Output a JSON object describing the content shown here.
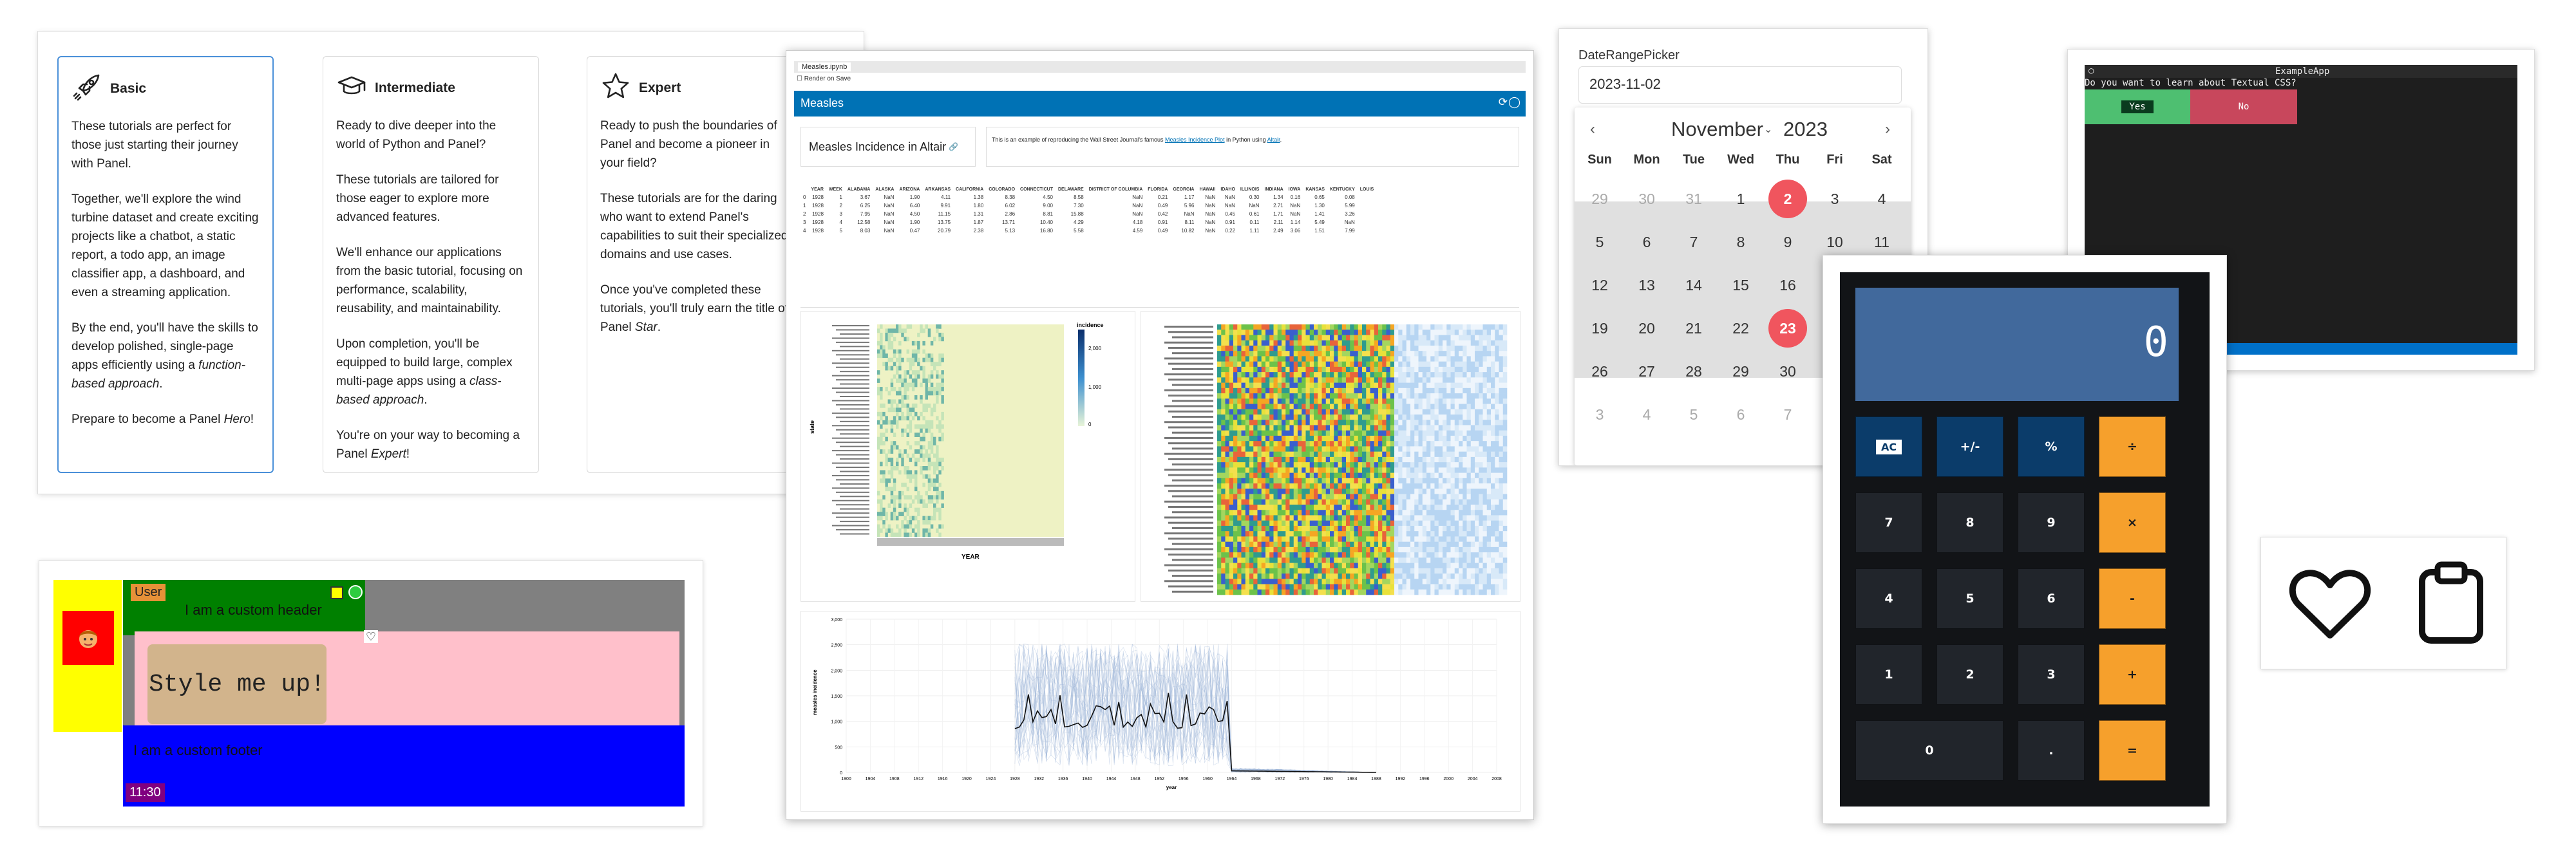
{
  "tutorials": {
    "cards": [
      {
        "title": "Basic",
        "icon": "rocket-icon",
        "p1": "These tutorials are perfect for those just starting their journey with Panel.",
        "p2": "Together, we'll explore the wind turbine dataset and create exciting projects like a chatbot, a static report, a todo app, an image classifier app, a dashboard, and even a streaming application.",
        "p3a": "By the end, you'll have the skills to develop polished, single-page apps efficiently using a ",
        "p3b": "function-based approach",
        "p3c": ".",
        "p4a": "Prepare to become a Panel ",
        "p4b": "Hero",
        "p4c": "!"
      },
      {
        "title": "Intermediate",
        "icon": "graduation-cap-icon",
        "p1": "Ready to dive deeper into the world of Python and Panel?",
        "p2": "These tutorials are tailored for those eager to explore more advanced features.",
        "p3": "We'll enhance our applications from the basic tutorial, focusing on performance, scalability, reusability, and maintainability.",
        "p4a": "Upon completion, you'll be equipped to build large, complex multi-page apps using a ",
        "p4b": "class-based approach",
        "p4c": ".",
        "p5a": "You're on your way to becoming a Panel ",
        "p5b": "Expert",
        "p5c": "!"
      },
      {
        "title": "Expert",
        "icon": "star-icon",
        "p1": "Ready to push the boundaries of Panel and become a pioneer in your field?",
        "p2": "These tutorials are for the daring who want to extend Panel's capabilities to suit their specialized domains and use cases.",
        "p3a": "Once you've completed these tutorials, you'll truly earn the title of Panel ",
        "p3b": "Star",
        "p3c": "."
      }
    ]
  },
  "styleapp": {
    "user_label": "User",
    "header_text": "I am a custom header",
    "main_text": "Style me up!",
    "footer_text": "I am a custom footer",
    "time_badge": "11:30",
    "avatar_icon": "face-icon",
    "heart_icon": "heart-icon",
    "colors": {
      "sidebar": "#ffff00",
      "header": "#008000",
      "main": "#ffc0cb",
      "footer": "#0000ff",
      "bg": "#808080",
      "button": "#d2b48c"
    }
  },
  "measles": {
    "tab_title": "Measles.ipynb",
    "render_label": "Render on Save",
    "header_title": "Measles",
    "card_title": "Measles Incidence in Altair",
    "intro_prefix": "This is an example of reproducing the Wall Street Journal's famous ",
    "intro_link": "Measles Incidence Plot",
    "intro_mid": " in Python using ",
    "intro_link2": "Altair",
    "intro_suffix": ".",
    "table": {
      "columns": [
        "",
        "YEAR",
        "WEEK",
        "ALABAMA",
        "ALASKA",
        "ARIZONA",
        "ARKANSAS",
        "CALIFORNIA",
        "COLORADO",
        "CONNECTICUT",
        "DELAWARE",
        "DISTRICT OF COLUMBIA",
        "FLORIDA",
        "GEORGIA",
        "HAWAII",
        "IDAHO",
        "ILLINOIS",
        "INDIANA",
        "IOWA",
        "KANSAS",
        "KENTUCKY",
        "LOUIS"
      ],
      "rows": [
        [
          "0",
          "1928",
          "1",
          "3.67",
          "NaN",
          "1.90",
          "4.11",
          "1.38",
          "8.38",
          "4.50",
          "8.58",
          "NaN",
          "0.21",
          "1.17",
          "NaN",
          "NaN",
          "0.30",
          "1.34",
          "0.16",
          "0.65",
          "0.08"
        ],
        [
          "1",
          "1928",
          "2",
          "6.25",
          "NaN",
          "6.40",
          "9.91",
          "1.80",
          "6.02",
          "9.00",
          "7.30",
          "NaN",
          "0.49",
          "5.96",
          "NaN",
          "NaN",
          "NaN",
          "2.71",
          "NaN",
          "1.30",
          "5.99"
        ],
        [
          "2",
          "1928",
          "3",
          "7.95",
          "NaN",
          "4.50",
          "11.15",
          "1.31",
          "2.86",
          "8.81",
          "15.88",
          "NaN",
          "0.42",
          "NaN",
          "NaN",
          "0.45",
          "0.61",
          "1.71",
          "NaN",
          "1.41",
          "3.26"
        ],
        [
          "3",
          "1928",
          "4",
          "12.58",
          "NaN",
          "1.90",
          "13.75",
          "1.87",
          "13.71",
          "10.40",
          "4.29",
          "4.18",
          "0.91",
          "8.11",
          "NaN",
          "0.91",
          "0.11",
          "2.11",
          "1.14",
          "5.49",
          "NaN"
        ],
        [
          "4",
          "1928",
          "5",
          "8.03",
          "NaN",
          "0.47",
          "20.79",
          "2.38",
          "5.13",
          "16.80",
          "5.58",
          "4.59",
          "0.49",
          "10.82",
          "NaN",
          "0.22",
          "1.11",
          "2.49",
          "3.06",
          "1.51",
          "7.99"
        ]
      ]
    },
    "heatmap1": {
      "legend_title": "incidence",
      "legend_ticks": [
        "2,000",
        "1,000",
        "0"
      ],
      "ylabel": "state",
      "xlabel": "YEAR"
    },
    "line": {
      "ylabel": "measles incidence",
      "xlabel": "year",
      "yticks": [
        "3,000",
        "2,500",
        "2,000",
        "1,500",
        "1,000",
        "500",
        "0"
      ],
      "xticks": [
        "1900",
        "1904",
        "1908",
        "1912",
        "1916",
        "1920",
        "1924",
        "1928",
        "1932",
        "1936",
        "1940",
        "1944",
        "1948",
        "1952",
        "1956",
        "1960",
        "1964",
        "1968",
        "1972",
        "1976",
        "1980",
        "1984",
        "1988",
        "1992",
        "1996",
        "2000",
        "2004",
        "2008"
      ]
    }
  },
  "datepicker": {
    "label": "DateRangePicker",
    "value": "2023-11-02",
    "month": "November",
    "year": "2023",
    "weekdays": [
      "Sun",
      "Mon",
      "Tue",
      "Wed",
      "Thu",
      "Fri",
      "Sat"
    ],
    "weeks": [
      [
        "29",
        "30",
        "31",
        "1",
        "2",
        "3",
        "4"
      ],
      [
        "5",
        "6",
        "7",
        "8",
        "9",
        "10",
        "11"
      ],
      [
        "12",
        "13",
        "14",
        "15",
        "16",
        "17",
        "18"
      ],
      [
        "19",
        "20",
        "21",
        "22",
        "23",
        "24",
        "25"
      ],
      [
        "26",
        "27",
        "28",
        "29",
        "30",
        "1",
        "2"
      ],
      [
        "3",
        "4",
        "5",
        "6",
        "7",
        "8",
        "9"
      ]
    ],
    "accent": "#f0555e"
  },
  "textual": {
    "title": "ExampleApp",
    "question": "Do you want to learn about Textual CSS?",
    "yes": "Yes",
    "no": "No"
  },
  "calculator": {
    "display": "0",
    "keys": [
      "AC",
      "+/-",
      "%",
      "÷",
      "7",
      "8",
      "9",
      "×",
      "4",
      "5",
      "6",
      "-",
      "1",
      "2",
      "3",
      "+",
      "0",
      ".",
      "="
    ]
  },
  "icons": {
    "items": [
      "heart-icon",
      "clipboard-icon"
    ]
  }
}
